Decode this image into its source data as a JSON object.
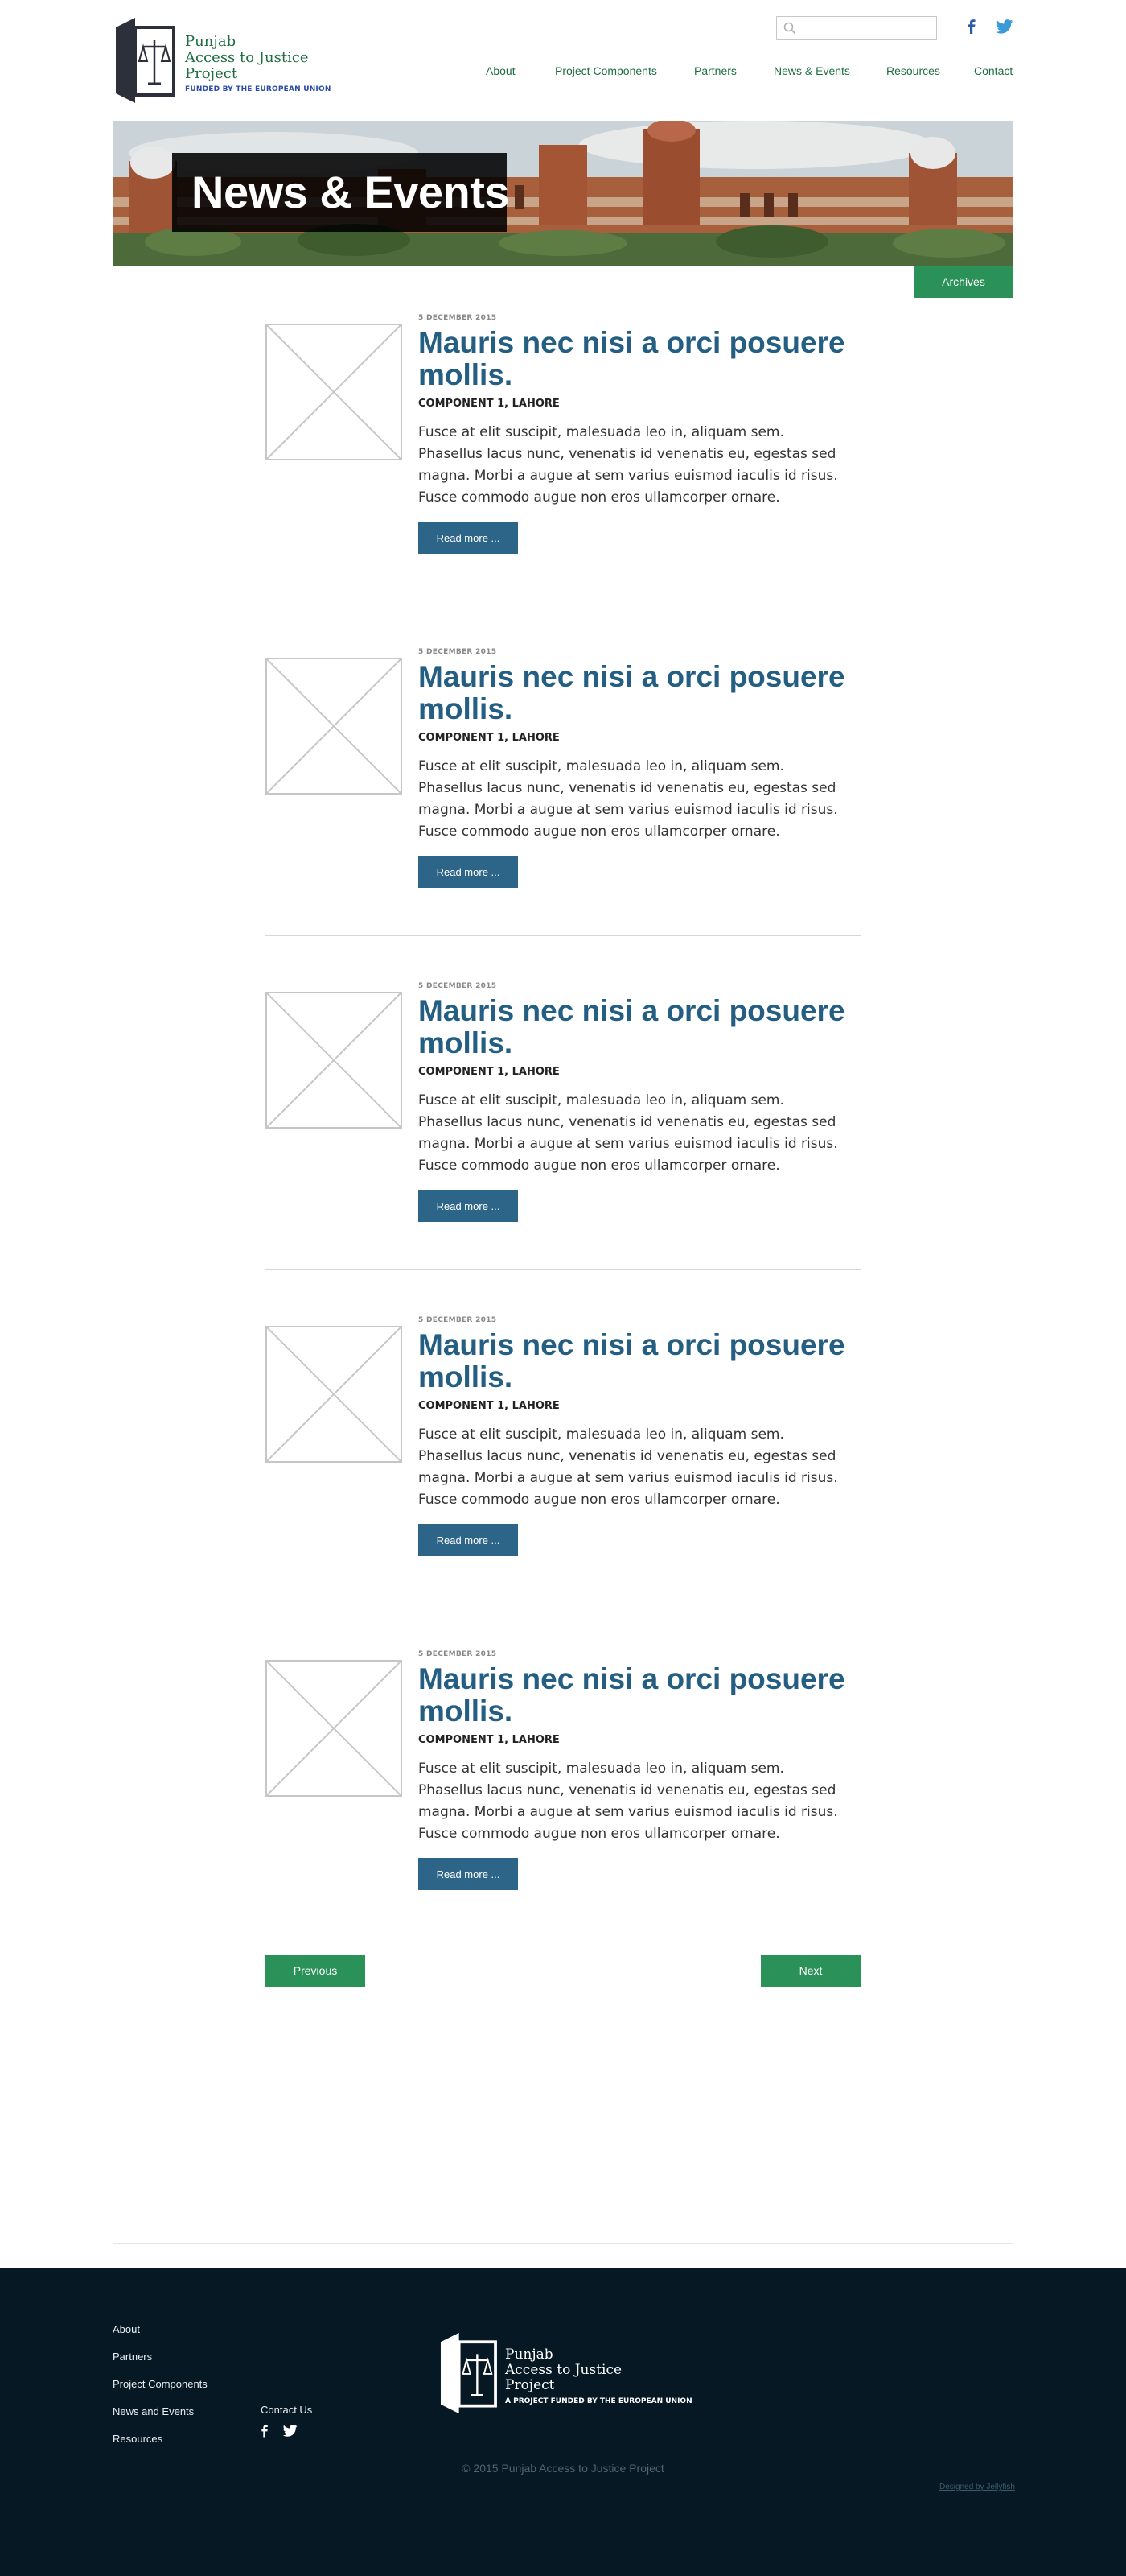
{
  "logo": {
    "line1": "Punjab",
    "line2": "Access to Justice",
    "line3": "Project",
    "funded": "FUNDED BY THE EUROPEAN UNION"
  },
  "search": {
    "placeholder": "",
    "value": ""
  },
  "social": {
    "facebook_icon": "facebook-icon",
    "twitter_icon": "twitter-icon"
  },
  "nav": {
    "items": [
      {
        "label": "About"
      },
      {
        "label": "Project Components"
      },
      {
        "label": "Partners"
      },
      {
        "label": "News & Events"
      },
      {
        "label": "Resources"
      },
      {
        "label": "Contact"
      }
    ]
  },
  "hero": {
    "title": "News & Events",
    "archives_label": "Archives"
  },
  "articles": [
    {
      "date": "5 DECEMBER 2015",
      "title": "Mauris nec nisi a orci posuere mollis.",
      "category": "COMPONENT 1, LAHORE",
      "excerpt": "Fusce at elit suscipit, malesuada leo in, aliquam sem. Phasellus lacus nunc, venenatis id venenatis eu, egestas sed magna. Morbi a augue at sem varius euismod iaculis id risus. Fusce commodo augue non eros ullamcorper ornare.",
      "read_more": "Read more ..."
    },
    {
      "date": "5 DECEMBER 2015",
      "title": "Mauris nec nisi a orci posuere mollis.",
      "category": "COMPONENT 1, LAHORE",
      "excerpt": "Fusce at elit suscipit, malesuada leo in, aliquam sem. Phasellus lacus nunc, venenatis id venenatis eu, egestas sed magna. Morbi a augue at sem varius euismod iaculis id risus. Fusce commodo augue non eros ullamcorper ornare.",
      "read_more": "Read more ..."
    },
    {
      "date": "5 DECEMBER 2015",
      "title": "Mauris nec nisi a orci posuere mollis.",
      "category": "COMPONENT 1, LAHORE",
      "excerpt": "Fusce at elit suscipit, malesuada leo in, aliquam sem. Phasellus lacus nunc, venenatis id venenatis eu, egestas sed magna. Morbi a augue at sem varius euismod iaculis id risus. Fusce commodo augue non eros ullamcorper ornare.",
      "read_more": "Read more ..."
    },
    {
      "date": "5 DECEMBER 2015",
      "title": "Mauris nec nisi a orci posuere mollis.",
      "category": "COMPONENT 1, LAHORE",
      "excerpt": "Fusce at elit suscipit, malesuada leo in, aliquam sem. Phasellus lacus nunc, venenatis id venenatis eu, egestas sed magna. Morbi a augue at sem varius euismod iaculis id risus. Fusce commodo augue non eros ullamcorper ornare.",
      "read_more": "Read more ..."
    },
    {
      "date": "5 DECEMBER 2015",
      "title": "Mauris nec nisi a orci posuere mollis.",
      "category": "COMPONENT 1, LAHORE",
      "excerpt": "Fusce at elit suscipit, malesuada leo in, aliquam sem. Phasellus lacus nunc, venenatis id venenatis eu, egestas sed magna. Morbi a augue at sem varius euismod iaculis id risus. Fusce commodo augue non eros ullamcorper ornare.",
      "read_more": "Read more ..."
    }
  ],
  "pagination": {
    "previous": "Previous",
    "next": "Next"
  },
  "footer": {
    "links": [
      {
        "label": "About"
      },
      {
        "label": "Partners"
      },
      {
        "label": "Project Components"
      },
      {
        "label": "News and Events"
      },
      {
        "label": "Resources"
      }
    ],
    "contact": "Contact Us",
    "logo": {
      "line1": "Punjab",
      "line2": "Access to Justice",
      "line3": "Project",
      "funded": "A PROJECT FUNDED BY THE EUROPEAN UNION"
    },
    "copyright": "© 2015 Punjab Access to Justice Project",
    "designed_by": "Designed by Jellyfish"
  },
  "colors": {
    "green": "#2a9158",
    "blue": "#2d6589",
    "title_blue": "#245e82",
    "footer_bg": "#061823"
  }
}
